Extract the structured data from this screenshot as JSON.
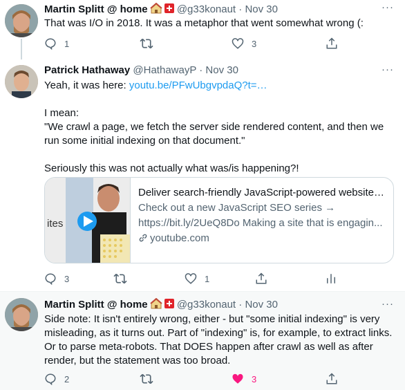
{
  "tweets": [
    {
      "name": "Martin Splitt @ home",
      "handle": "@g33konaut",
      "date": "Nov 30",
      "text": "That was I/O in 2018. It was a metaphor that went somewhat wrong (:",
      "actions": {
        "reply": "1",
        "retweet": "",
        "like": "3"
      }
    },
    {
      "name": "Patrick Hathaway",
      "handle": "@HathawayP",
      "date": "Nov 30",
      "intro": "Yeah, it was here: ",
      "link": "youtu.be/PFwUbgvpdaQ?t=…",
      "para1_line1": "I mean:",
      "para1_line2": "\"We crawl a page, we fetch the server side rendered content, and then we",
      "para1_line3": "run some initial indexing on that document.\"",
      "para2": "Seriously this was not actually what was/is happening?!",
      "card": {
        "title": "Deliver search-friendly JavaScript-powered websites (...",
        "desc_line1": "Check out a new JavaScript SEO series →",
        "desc_line2": "https://bit.ly/2UeQ8Do Making a site that is engagin...",
        "domain": "youtube.com",
        "thumb_text": "ites"
      },
      "actions": {
        "reply": "3",
        "retweet": "",
        "like": "1"
      }
    },
    {
      "name": "Martin Splitt @ home",
      "handle": "@g33konaut",
      "date": "Nov 30",
      "line1": "Side note: It isn't entirely wrong, either - but \"some initial indexing\" is very",
      "line2": "misleading, as it turns out. Part of \"indexing\" is, for example, to extract links.",
      "line3": "Or to parse meta-robots. That DOES happen after crawl as well as after",
      "line4": "render, but the statement was too broad.",
      "actions": {
        "reply": "2",
        "retweet": "",
        "like": "3"
      }
    }
  ],
  "dot": "·",
  "more": "···",
  "colors": {
    "accent": "#1d9bf0",
    "like_active": "#f91880",
    "muted": "#536471"
  }
}
